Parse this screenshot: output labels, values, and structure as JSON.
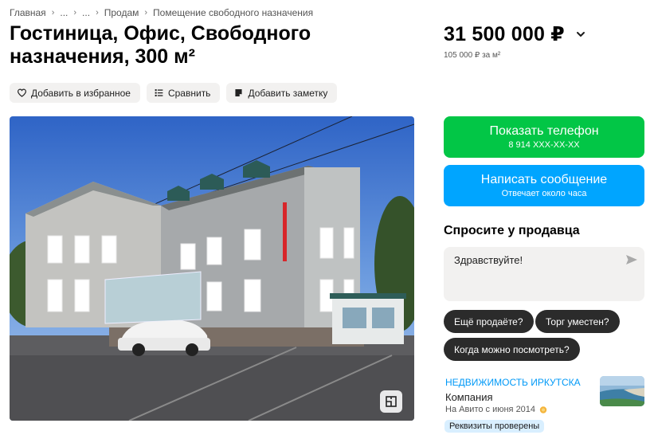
{
  "breadcrumb": {
    "items": [
      "Главная",
      "...",
      "...",
      "Продам",
      "Помещение свободного назначения"
    ]
  },
  "listing": {
    "title": "Гостиница, Офис, Свободного назначения, 300 м²",
    "price": "31 500 000 ₽",
    "price_per_m2": "105 000 ₽ за м²"
  },
  "actions": {
    "favorite": "Добавить в избранное",
    "compare": "Сравнить",
    "note": "Добавить заметку"
  },
  "contact": {
    "phone_title": "Показать телефон",
    "phone_masked": "8 914 XXX-XX-XX",
    "message_title": "Написать сообщение",
    "message_sub": "Отвечает около часа"
  },
  "ask": {
    "title": "Спросите у продавца",
    "message_value": "Здравствуйте!",
    "chips": [
      "Ещё продаёте?",
      "Торг уместен?",
      "Когда можно посмотреть?"
    ]
  },
  "seller": {
    "name": "НЕДВИЖИМОСТЬ ИРКУТСКА",
    "type": "Компания",
    "since": "На Авито с июня 2014",
    "badge": "Реквизиты проверены"
  },
  "colors": {
    "phone_button": "#02c646",
    "message_button": "#00a5ff",
    "chip": "#2b2b2b",
    "seller_link": "#0099f7",
    "badge_bg": "#d9efff"
  }
}
